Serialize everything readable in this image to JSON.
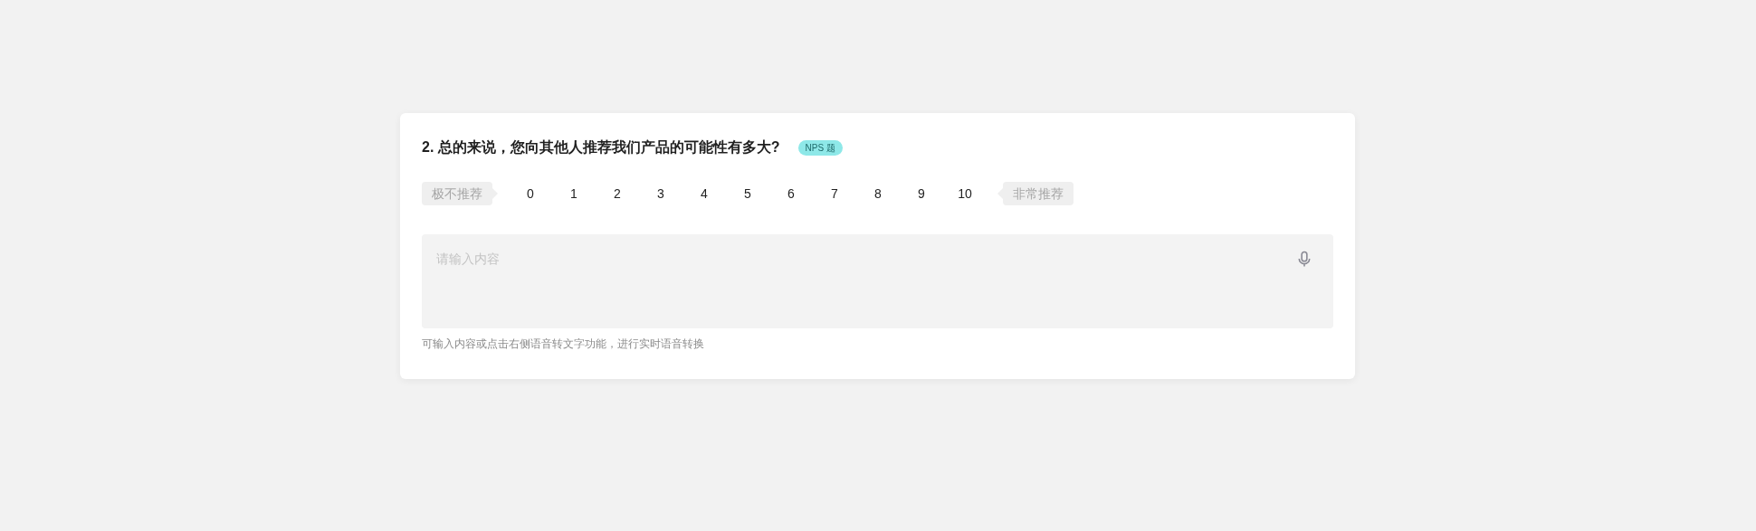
{
  "question": {
    "title": "2. 总的来说，您向其他人推荐我们产品的可能性有多大?",
    "badge": "NPS 题"
  },
  "scale": {
    "low_label": "极不推荐",
    "high_label": "非常推荐",
    "options": [
      "0",
      "1",
      "2",
      "3",
      "4",
      "5",
      "6",
      "7",
      "8",
      "9",
      "10"
    ]
  },
  "answer": {
    "placeholder": "请输入内容",
    "hint": "可输入内容或点击右侧语音转文字功能，进行实时语音转换"
  }
}
